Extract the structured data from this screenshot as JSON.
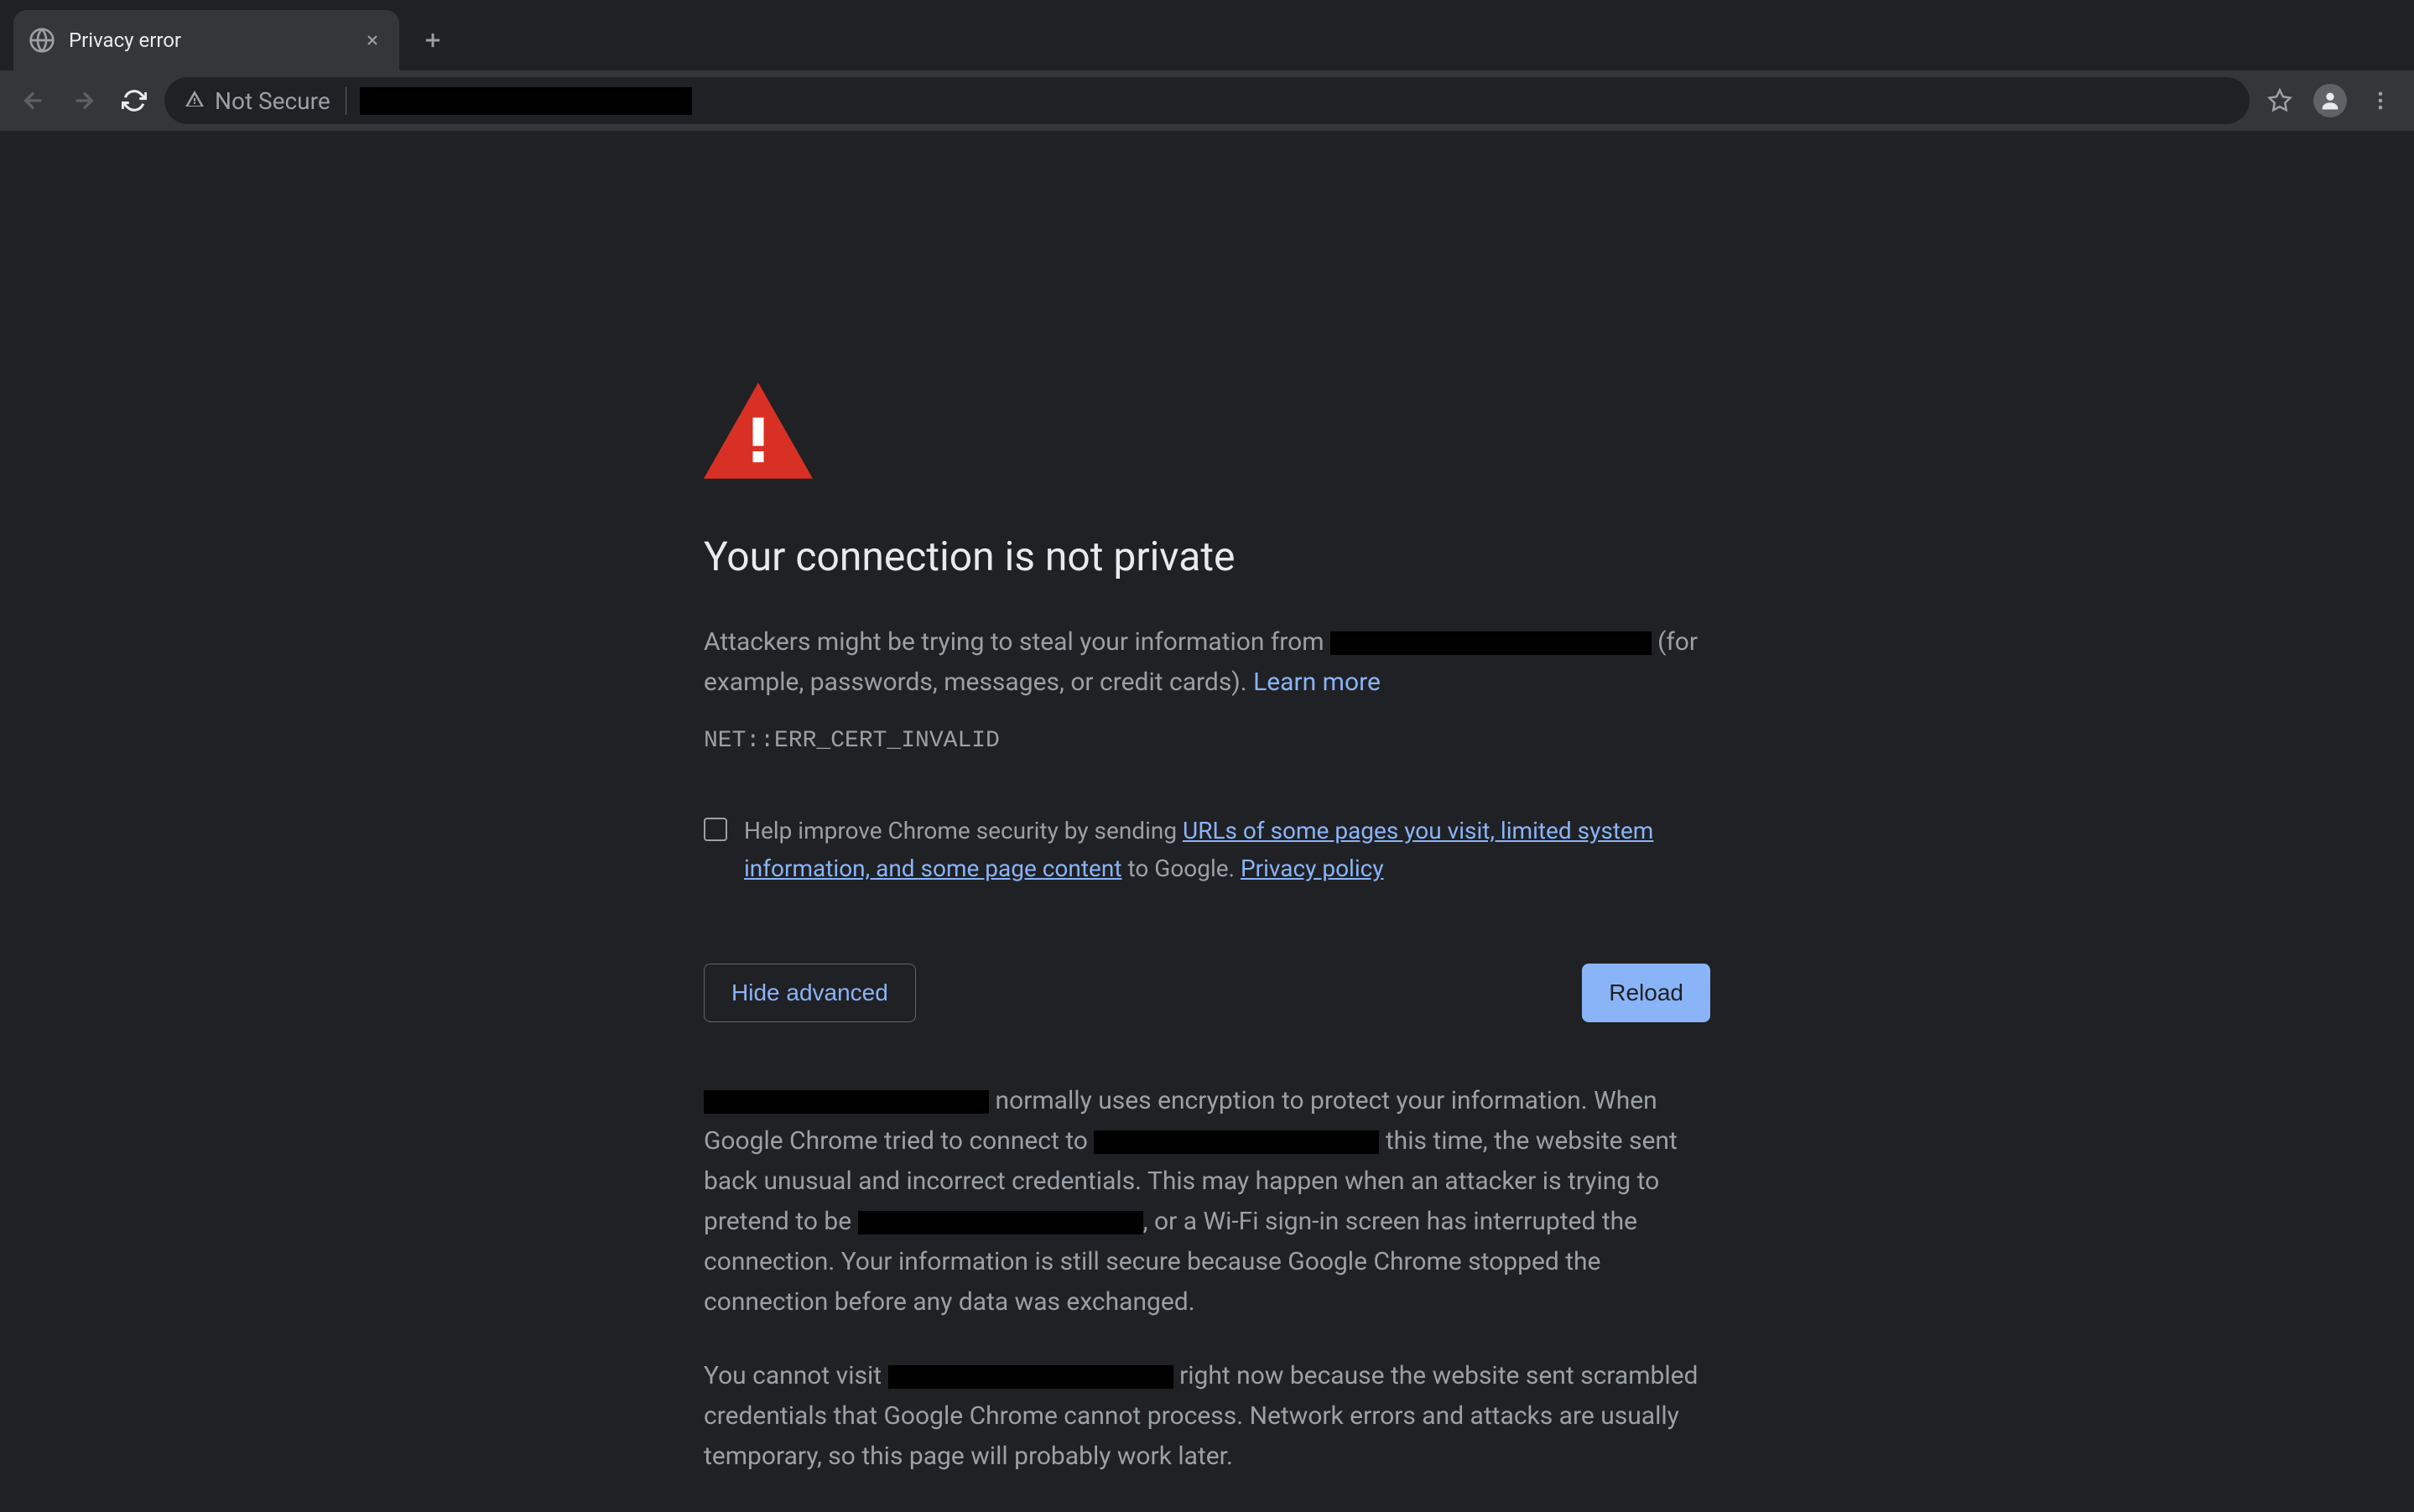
{
  "tab": {
    "title": "Privacy error"
  },
  "toolbar": {
    "security_label": "Not Secure",
    "url_redacted": "████████████████████"
  },
  "page": {
    "heading": "Your connection is not private",
    "paragraph1_before": "Attackers might be trying to steal your information from ",
    "paragraph1_redacted": "██████████████████",
    "paragraph1_after": " (for example, passwords, messages, or credit cards). ",
    "learn_more": "Learn more",
    "error_code": "NET::ERR_CERT_INVALID",
    "opt_in_before": "Help improve Chrome security by sending ",
    "opt_in_link1": "URLs of some pages you visit, limited system information, and some page content",
    "opt_in_mid": " to Google. ",
    "opt_in_link2": "Privacy policy",
    "hide_advanced": "Hide advanced",
    "reload": "Reload",
    "advanced_p1_redacted1": "████████████████",
    "advanced_p1_a": " normally uses encryption to protect your information. When Google Chrome tried to connect to ",
    "advanced_p1_redacted2": "████████████████",
    "advanced_p1_b": " this time, the website sent back unusual and incorrect credentials. This may happen when an attacker is trying to pretend to be ",
    "advanced_p1_redacted3": "████████████████",
    "advanced_p1_c": ", or a Wi-Fi sign-in screen has interrupted the connection. Your information is still secure because Google Chrome stopped the connection before any data was exchanged.",
    "advanced_p2_a": "You cannot visit ",
    "advanced_p2_redacted": "████████████████",
    "advanced_p2_b": " right now because the website sent scrambled credentials that Google Chrome cannot process. Network errors and attacks are usually temporary, so this page will probably work later."
  }
}
